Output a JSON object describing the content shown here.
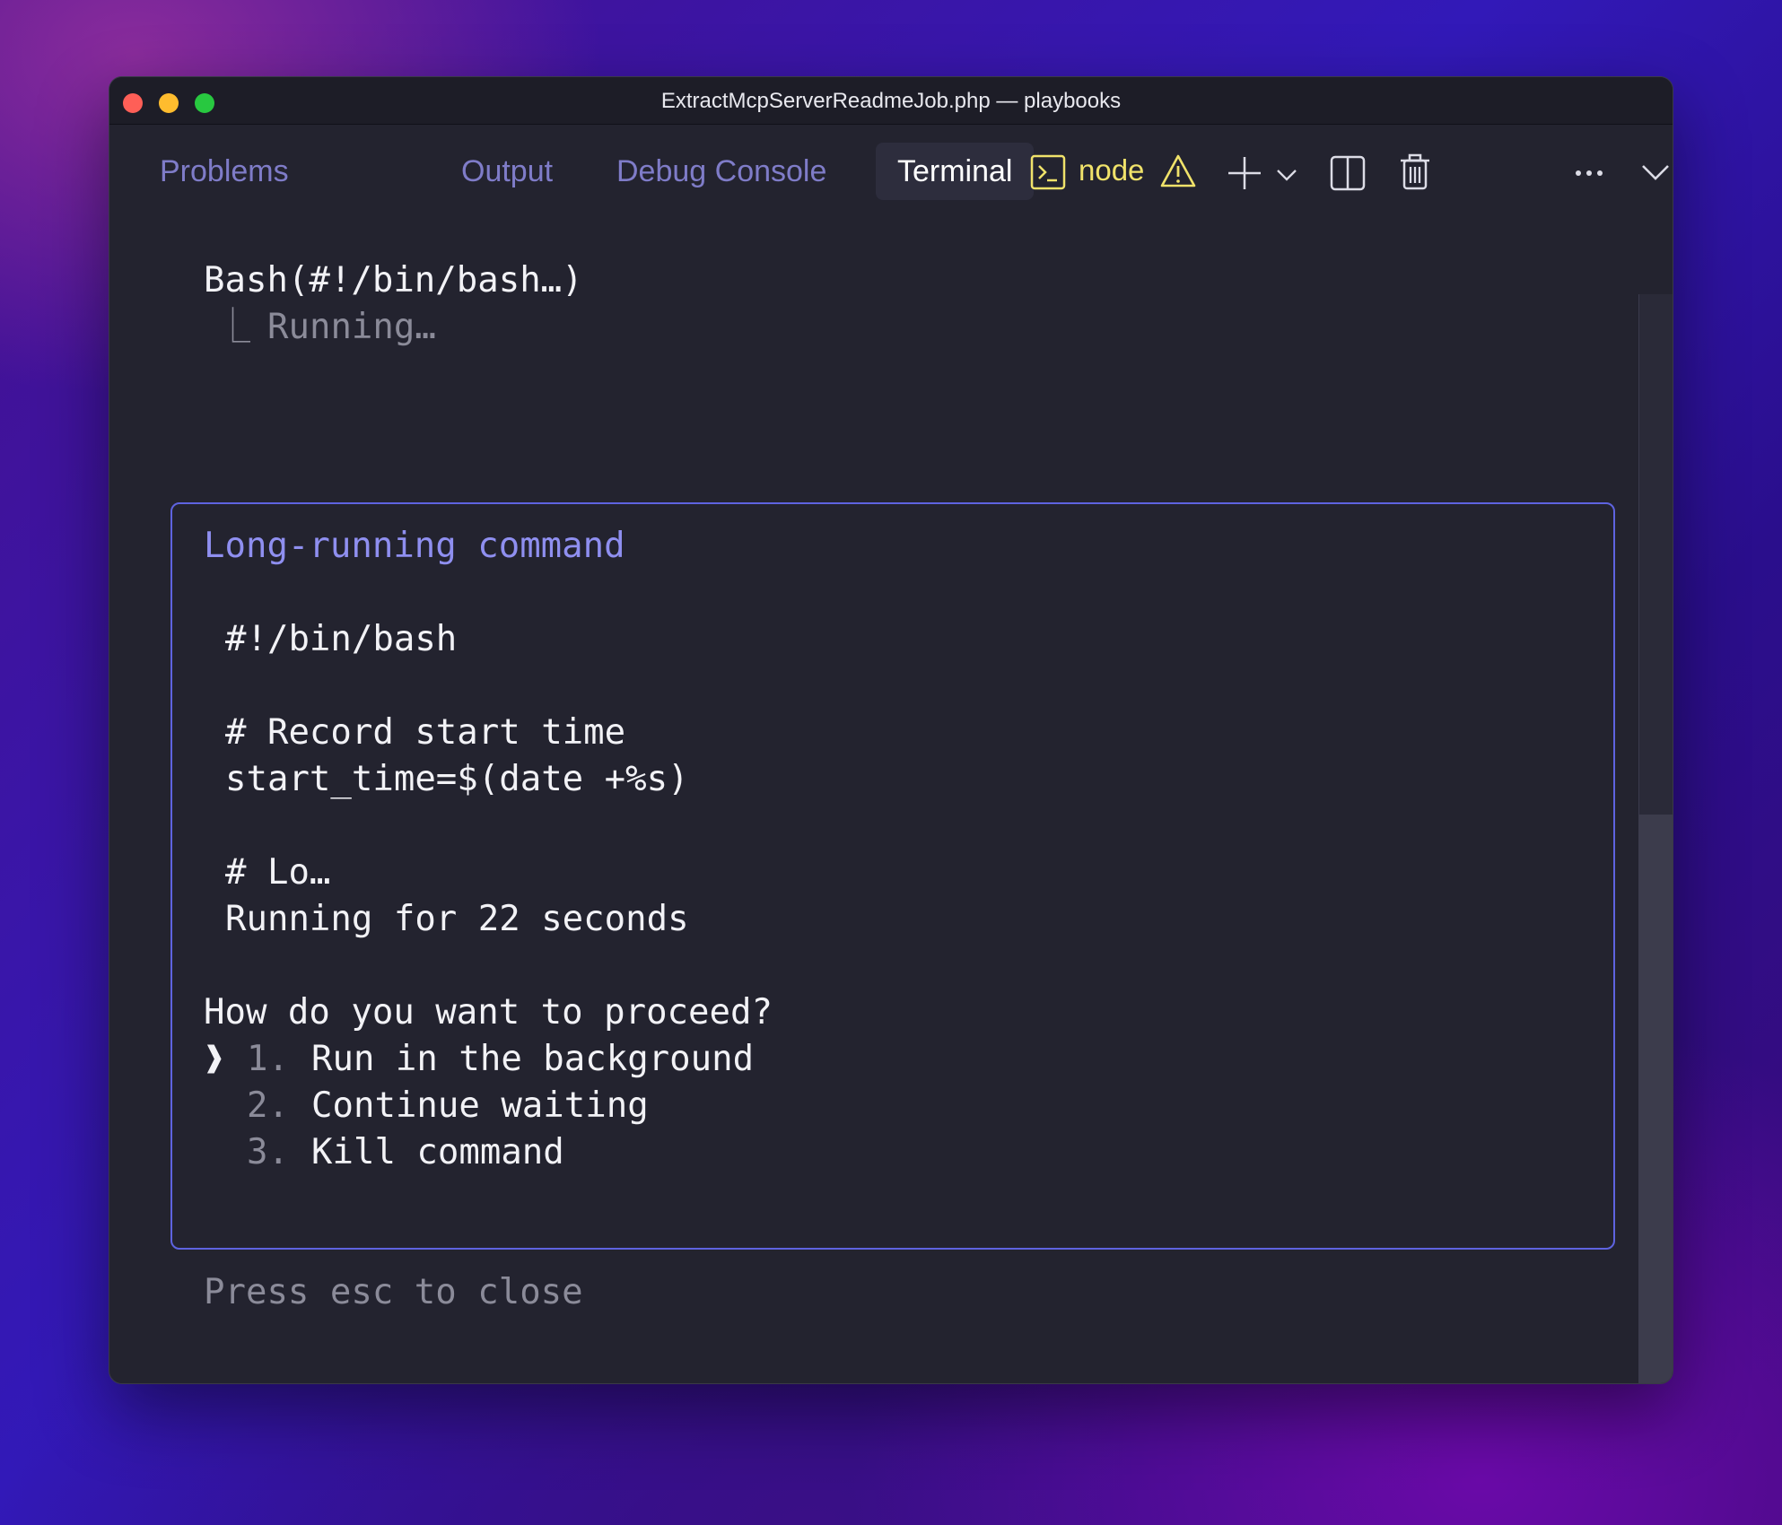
{
  "window": {
    "title": "ExtractMcpServerReadmeJob.php — playbooks"
  },
  "panel": {
    "tabs": [
      {
        "label": "Problems",
        "active": false
      },
      {
        "label": "Output",
        "active": false
      },
      {
        "label": "Debug Console",
        "active": false
      },
      {
        "label": "Terminal",
        "active": true
      }
    ],
    "terminal_name": "node",
    "icons": [
      "terminal-icon",
      "warning-icon",
      "plus-icon",
      "chevron-down-icon",
      "split-icon",
      "trash-icon",
      "more-icon",
      "chevron-down-icon",
      "close-icon"
    ]
  },
  "terminal": {
    "tool_call": "Bash(#!/bin/bash…)",
    "tool_status_prefix": "⎿",
    "tool_status": "Running…",
    "dialog": {
      "title": "Long-running command",
      "code_lines": [
        "#!/bin/bash",
        "",
        "# Record start time",
        "start_time=$(date +%s)",
        "",
        "# Lo…"
      ],
      "running_text": "Running for 22 seconds",
      "question": "How do you want to proceed?",
      "selector": "❱",
      "options": [
        {
          "number": "1.",
          "label": "Run in the background",
          "selected": true
        },
        {
          "number": "2.",
          "label": "Continue waiting",
          "selected": false
        },
        {
          "number": "3.",
          "label": "Kill command",
          "selected": false
        }
      ]
    },
    "hint": "Press esc to close"
  },
  "colors": {
    "accent": "#8f8ff0",
    "dialog_border": "#5e63e0",
    "terminal_bg": "#23232f",
    "node_yellow": "#f0e26a"
  }
}
